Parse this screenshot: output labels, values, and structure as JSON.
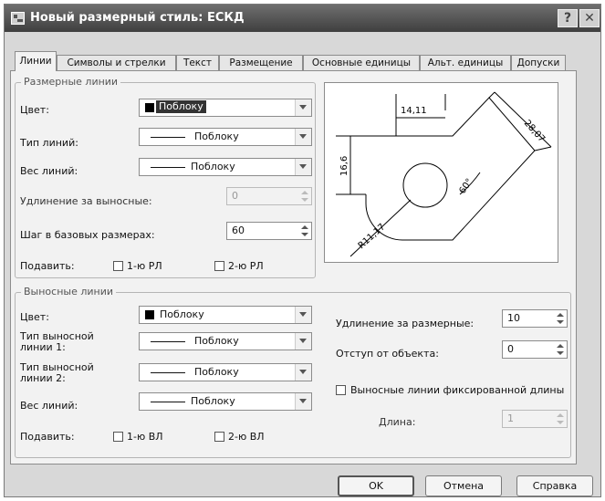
{
  "window": {
    "title": "Новый размерный стиль: ЕСКД",
    "help_symbol": "?",
    "close_symbol": "✕"
  },
  "tabs": [
    "Линии",
    "Символы и стрелки",
    "Текст",
    "Размещение",
    "Основные единицы",
    "Альт. единицы",
    "Допуски"
  ],
  "dim_lines": {
    "group_title": "Размерные линии",
    "color_label": "Цвет:",
    "color_value": "Поблоку",
    "linetype_label": "Тип линий:",
    "linetype_value": "Поблоку",
    "lineweight_label": "Вес линий:",
    "lineweight_value": "Поблоку",
    "extend_label": "Удлинение за выносные:",
    "extend_value": "0",
    "baseline_label": "Шаг в базовых размерах:",
    "baseline_value": "60",
    "suppress_label": "Подавить:",
    "suppress1_label": "1-ю РЛ",
    "suppress2_label": "2-ю РЛ"
  },
  "ext_lines": {
    "group_title": "Выносные линии",
    "color_label": "Цвет:",
    "color_value": "Поблоку",
    "linetype1_label": "Тип выносной\nлинии 1:",
    "linetype1_value": "Поблоку",
    "linetype2_label": "Тип выносной\nлинии 2:",
    "linetype2_value": "Поблоку",
    "lineweight_label": "Вес линий:",
    "lineweight_value": "Поблоку",
    "suppress_label": "Подавить:",
    "suppress1_label": "1-ю ВЛ",
    "suppress2_label": "2-ю ВЛ",
    "extend_beyond_label": "Удлинение за размерные:",
    "extend_beyond_value": "10",
    "offset_label": "Отступ от объекта:",
    "offset_value": "0",
    "fixed_label": "Выносные линии фиксированной длины",
    "length_label": "Длина:",
    "length_value": "1"
  },
  "preview": {
    "dim_top": "14,11",
    "dim_left": "16,6",
    "dim_right": "28,07",
    "dim_angle": "60°",
    "dim_radius": "R11,17"
  },
  "buttons": {
    "ok": "OK",
    "cancel": "Отмена",
    "help": "Справка"
  },
  "colors": {
    "titlebar": "#4a4a4a",
    "panel": "#f2f2f2",
    "window": "#d8d8d8"
  },
  "icons": {
    "title": "dialog-icon",
    "help": "help-icon",
    "close": "close-icon"
  }
}
